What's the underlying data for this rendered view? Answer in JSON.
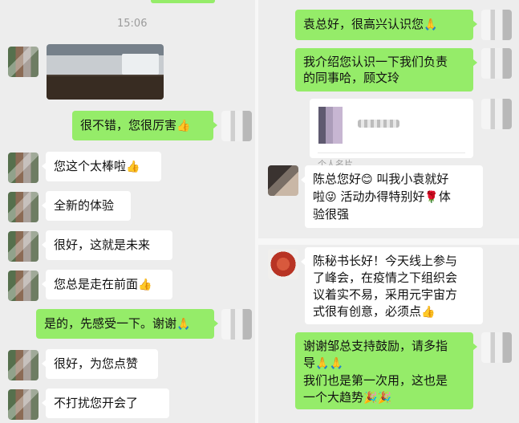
{
  "left_chat": {
    "timestamp": "15:06",
    "messages": [
      {
        "id": "m1",
        "sender": "self",
        "text": "很不错，您很厉害",
        "emoji": "👍"
      },
      {
        "id": "m2",
        "sender": "peer",
        "text": "您这个太棒啦",
        "emoji": "👍"
      },
      {
        "id": "m3",
        "sender": "peer",
        "text": "全新的体验",
        "emoji": ""
      },
      {
        "id": "m4",
        "sender": "peer",
        "text": "很好，这就是未来",
        "emoji": ""
      },
      {
        "id": "m5",
        "sender": "peer",
        "text": "您总是走在前面",
        "emoji": "👍"
      },
      {
        "id": "m6",
        "sender": "self",
        "text": "是的，先感受一下。谢谢",
        "emoji": "🙏"
      },
      {
        "id": "m7",
        "sender": "peer",
        "text": "很好，为您点赞",
        "emoji": ""
      },
      {
        "id": "m8",
        "sender": "peer",
        "text": "不打扰您开会了",
        "emoji": ""
      }
    ]
  },
  "right_chat": {
    "messages": [
      {
        "id": "r1",
        "sender": "self",
        "text": "袁总好，很高兴认识您",
        "emoji": "🙏"
      },
      {
        "id": "r2",
        "sender": "self",
        "line1": "我介绍您认识一下我们负责",
        "line2": "的同事哈，顾文玲"
      },
      {
        "id": "r3",
        "sender": "self",
        "type": "contact_card",
        "label": "个人名片"
      },
      {
        "id": "r4",
        "sender": "peer",
        "line1": "陈总您好",
        "emoji1": "😊",
        "line1b": "叫我小袁就好",
        "line2a": "啦",
        "emoji2": "😜",
        "line2b": "活动办得特别好",
        "emoji3": "🌹",
        "line2c": "体",
        "line3": "验很强"
      },
      {
        "id": "r5",
        "sender": "peer",
        "line1": "陈秘书长好！今天线上参与",
        "line2": "了峰会，在疫情之下组织会",
        "line3": "议着实不易，采用元宇宙方",
        "line4": "式很有创意，必须点",
        "emoji": "👍"
      },
      {
        "id": "r6",
        "sender": "self",
        "line1": "谢谢邹总支持鼓励，请多指",
        "line2": "导",
        "emoji1": "🙏🙏",
        "line3": "我们也是第一次用，这也是",
        "line4": "一个大趋势",
        "emoji2": "🎉🎉"
      }
    ]
  },
  "icons": {
    "bubble_tail": "chat-bubble-tail",
    "photo": "photo-thumbnail",
    "contact": "contact-card-icon"
  },
  "colors": {
    "background": "#ededed",
    "outgoing_bubble": "#95ec69",
    "incoming_bubble": "#ffffff",
    "timestamp": "#9b9b9b"
  }
}
